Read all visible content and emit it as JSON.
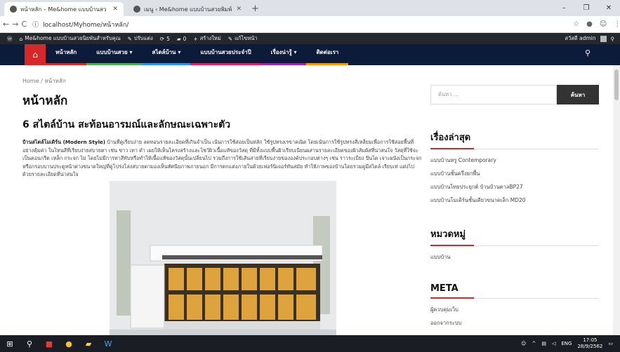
{
  "browser": {
    "tabs": [
      {
        "title": "หน้าหลัก – Me&home แบบบ้านสว",
        "active": true
      },
      {
        "title": "เมนู ‹ Me&home แบบบ้านสวยพิมพ์",
        "active": false
      }
    ],
    "new_tab": "+",
    "window_controls": [
      "–",
      "❐",
      "✕"
    ],
    "url_scheme_icon": "ⓘ",
    "url": "localhost/Myhome/หน้าหลัก/"
  },
  "adminbar": {
    "site": "Me&home แบบบ้านสวยนิยพันสำหรับคุณ",
    "customize": "ปรับแต่ง",
    "updates": "5",
    "comments": "0",
    "new": "สร้างใหม่",
    "edit": "แก้ไขหน้า",
    "greeting": "สวัสดี admin"
  },
  "nav": {
    "items": [
      {
        "label": "หน้าหลัก",
        "color": "#d62828"
      },
      {
        "label": "แบบบ้านสวย ▾",
        "color": "#4caf50"
      },
      {
        "label": "สไตล์บ้าน ▾",
        "color": "#2196f3"
      },
      {
        "label": "แบบบ้านสวยประจำปี",
        "color": "#e91e63"
      },
      {
        "label": "เรื่องน่ารู้ ▾",
        "color": "#9c27b0"
      },
      {
        "label": "ติดต่อเรา",
        "color": "#ff9800"
      }
    ]
  },
  "main": {
    "breadcrumb": "Home / หน้าหลัก",
    "page_title": "หน้าหลัก",
    "post_title": "6 สไตล์บ้าน สะท้อนอารมณ์และลักษณะเฉพาะตัว",
    "post_lead": "บ้านสไตล์โมเดิร์น (Modern Style)",
    "post_body": " บ้านที่ดูเรียบง่าย ลดทอนรายละเอียดที่เกินจำเป็น เน้นการใช้สอยเป็นหลัก ใช้รูปทรงเรขาคณิต โดยเน้นการใช้รูปทรงสี่เหลี่ยมเพื่อการใช้สอยพื้นที่อย่างคุ้มค่า ในโทนสีที่เรียบง่ายสบายตา เช่น ขาว เทา ดำ เผยให้เห็นโครงสร้างและโชว์ผิวเนื้อแท้ของวัสดุ ที่มีทั้งแบบพื้นผิวเรียบเนียนผสานรายละเอียดของผิวสัมผัสที่น่าสนใจ วัสดุที่ใช้จะเป็นคอนกรีต เหล็ก กระจก ไม่ โดยไม่มีการทาสีทับหรือทำให้เนื้อแท้ของวัสดุนั้นเปลี่ยนไป รวมถึงการใช้เส้นสายที่เรียบง่ายขององค์ประกอบต่างๆ เช่น ราวระเบียง ปันได เจาะผนังเป็นกระจกหรือกรอบบานประตูหน้าต่างขนาดใหญ่ที่ดูโปร่งโล่งสบายตามองเห็นทัศนียภาพภายนอก มีการตกแต่งภายในด้วยเฟอร์นิเจอร์ทันสมัย ทำให้ภาพของบ้านโดยรวมดูมีสไตล์ เรียบเท่ แต่งไปด้วยรายละเอียดที่น่าสนใจ"
  },
  "sidebar": {
    "search_placeholder": "ค้นหา ...",
    "search_button": "ค้นหา",
    "recent_title": "เรื่องล่าสุด",
    "recent": [
      "แบบบ้านหรู Contemporary",
      "แบบบ้านชั้นครึ่งยกพื้น",
      "แบบบ้านไทยประยุกต์ บ้านบ้านตาลBP27",
      "แบบบ้านโมเดิร์นชั้นเดียวขนาดเล็ก MD20"
    ],
    "category_title": "หมวดหมู่",
    "categories": [
      "แบบบ้าน"
    ],
    "meta_title": "META",
    "meta": [
      "ผู้ควบคุมเว็บ",
      "ออกจากระบบ"
    ]
  },
  "taskbar": {
    "lang": "ENG",
    "time": "17:05",
    "date": "28/9/2562"
  }
}
